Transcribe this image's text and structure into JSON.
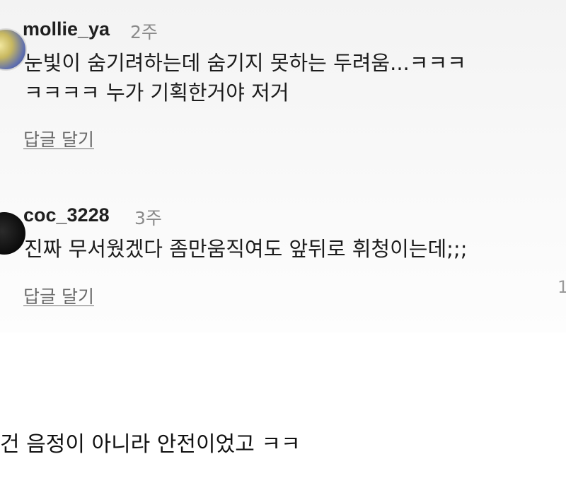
{
  "comments": [
    {
      "username": "mollie_ya",
      "timestamp": "2주",
      "text_lines": [
        "눈빛이 숨기려하는데 숨기지 못하는 두려움...ㅋㅋㅋ",
        "ㅋㅋㅋㅋ 누가 기획한거야 저거"
      ],
      "reply_label": "답글 달기"
    },
    {
      "username": "coc_3228",
      "timestamp": "3주",
      "text_lines": [
        "진짜 무서웠겠다 좀만움직여도 앞뒤로 휘청이는데;;;"
      ],
      "reply_label": "답글 달기"
    }
  ],
  "edge_glyph": "1",
  "caption": "건 음정이 아니라 안전이었고 ㅋㅋ"
}
